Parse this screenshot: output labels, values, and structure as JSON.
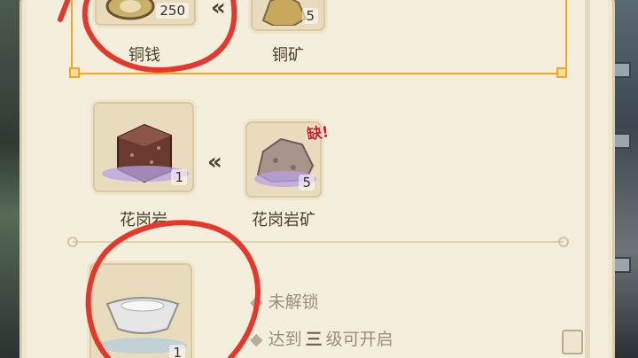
{
  "top_row": {
    "product": {
      "name": "铜钱",
      "count": "250",
      "icon": "copper-coin-icon"
    },
    "material": {
      "name": "铜矿",
      "count": "5",
      "icon": "copper-ore-icon"
    }
  },
  "middle_row": {
    "product": {
      "name": "花岗岩",
      "count": "1",
      "icon": "granite-block-icon"
    },
    "material": {
      "name": "花岗岩矿",
      "count": "5",
      "icon": "granite-ore-icon"
    },
    "shortage_badge": "缺!"
  },
  "locked_row": {
    "product": {
      "count": "1",
      "icon": "silver-ingot-icon"
    },
    "status_text": "未解锁",
    "requirement_prefix": "达到",
    "requirement_level": "三",
    "requirement_suffix": "级可开启"
  },
  "colors": {
    "selection_border": "#f2a623",
    "annotation_red": "#e8372a",
    "shortage_red": "#d21d1d"
  }
}
